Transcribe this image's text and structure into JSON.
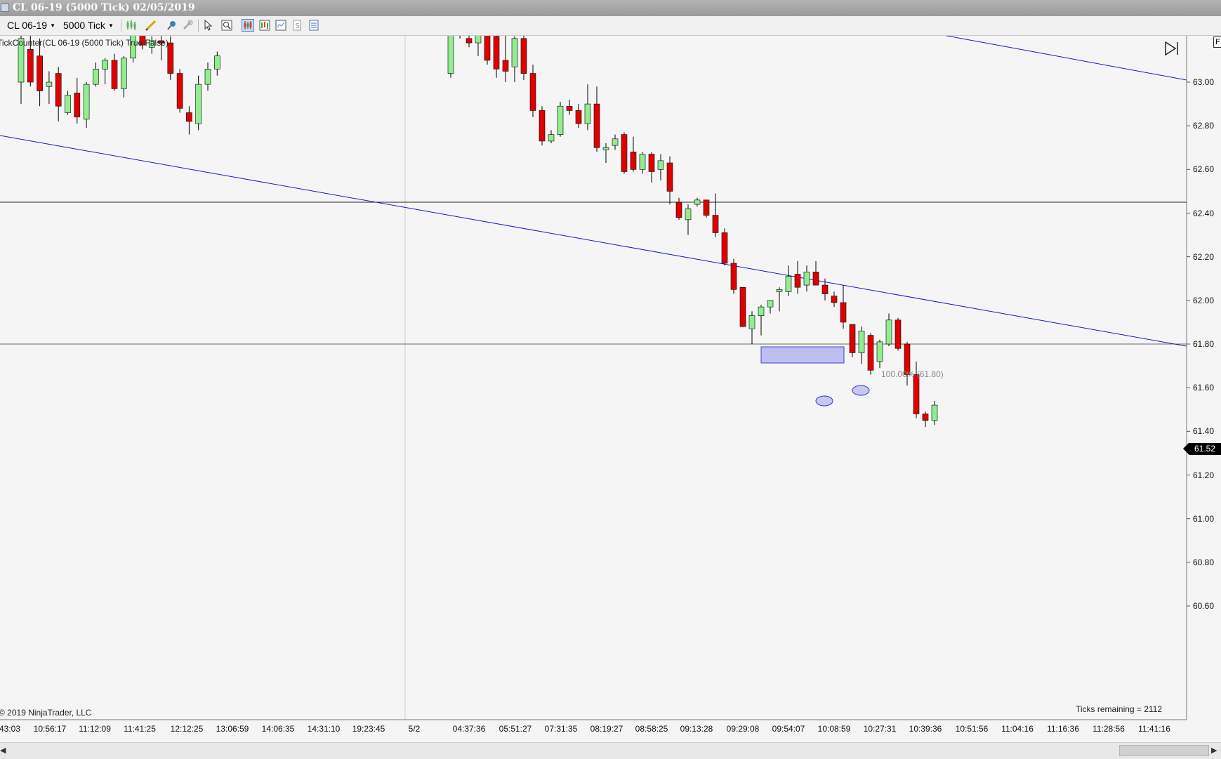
{
  "window": {
    "title": "CL 06-19 (5000 Tick)  02/05/2019"
  },
  "toolbar": {
    "instrument": "CL 06-19",
    "interval": "5000 Tick",
    "icons": [
      "bar-type-icon",
      "drawing-tools-icon",
      "marker-icon",
      "attach-icon",
      "cursor-icon",
      "zoom-icon",
      "chart-style-icon",
      "data-box-icon",
      "properties-icon",
      "strategy-icon",
      "indicators-icon"
    ]
  },
  "chart": {
    "indicator_label": "TickCounter(CL 06-19 (5000 Tick) True False)",
    "copyright": "© 2019 NinjaTrader, LLC",
    "ticks_remaining": "Ticks remaining = 2112",
    "last_price": "61.52",
    "fib_label": "100.00% (61.80)",
    "right_tab": "F"
  },
  "chart_data": {
    "type": "candlestick",
    "price_labels": [
      "63.00",
      "62.80",
      "62.60",
      "62.40",
      "62.20",
      "62.00",
      "61.80",
      "61.60",
      "61.40",
      "61.20",
      "61.00",
      "60.80",
      "60.60"
    ],
    "time_labels": [
      "43:03",
      "10:56:17",
      "11:12:09",
      "11:41:25",
      "12:12:25",
      "13:06:59",
      "14:06:35",
      "14:31:10",
      "19:23:45",
      "5/2",
      "04:37:36",
      "05:51:27",
      "07:31:35",
      "08:19:27",
      "08:58:25",
      "09:13:28",
      "09:29:08",
      "09:54:07",
      "10:08:59",
      "10:27:31",
      "10:39:36",
      "10:51:56",
      "11:04:16",
      "11:16:36",
      "11:28:56",
      "11:41:16"
    ],
    "ylim": [
      60.48,
      63.24
    ],
    "horizontal_lines": [
      62.45,
      61.8
    ],
    "colors": {
      "up": "#90ee90",
      "down": "#e00000",
      "trendline": "#1515d0",
      "zone": "#9999ee"
    },
    "candles": [
      {
        "o": 63.0,
        "h": 63.25,
        "l": 62.9,
        "c": 63.2
      },
      {
        "o": 63.15,
        "h": 63.3,
        "l": 62.98,
        "c": 63.0
      },
      {
        "o": 63.12,
        "h": 63.2,
        "l": 62.89,
        "c": 62.96
      },
      {
        "o": 62.98,
        "h": 63.05,
        "l": 62.9,
        "c": 63.0
      },
      {
        "o": 63.04,
        "h": 63.07,
        "l": 62.82,
        "c": 62.89
      },
      {
        "o": 62.86,
        "h": 62.96,
        "l": 62.85,
        "c": 62.94
      },
      {
        "o": 62.95,
        "h": 63.02,
        "l": 62.81,
        "c": 62.84
      },
      {
        "o": 62.83,
        "h": 63.0,
        "l": 62.79,
        "c": 62.99
      },
      {
        "o": 62.99,
        "h": 63.09,
        "l": 62.98,
        "c": 63.06
      },
      {
        "o": 63.06,
        "h": 63.11,
        "l": 62.99,
        "c": 63.1
      },
      {
        "o": 63.1,
        "h": 63.13,
        "l": 62.96,
        "c": 62.97
      },
      {
        "o": 62.97,
        "h": 63.12,
        "l": 62.93,
        "c": 63.11
      },
      {
        "o": 63.11,
        "h": 63.28,
        "l": 63.09,
        "c": 63.27
      },
      {
        "o": 63.27,
        "h": 63.32,
        "l": 63.15,
        "c": 63.17
      },
      {
        "o": 63.16,
        "h": 63.21,
        "l": 63.13,
        "c": 63.19
      },
      {
        "o": 63.19,
        "h": 63.22,
        "l": 63.1,
        "c": 63.18
      },
      {
        "o": 63.18,
        "h": 63.21,
        "l": 63.01,
        "c": 63.04
      },
      {
        "o": 63.04,
        "h": 63.06,
        "l": 62.86,
        "c": 62.88
      },
      {
        "o": 62.86,
        "h": 62.89,
        "l": 62.76,
        "c": 62.82
      },
      {
        "o": 62.81,
        "h": 63.03,
        "l": 62.78,
        "c": 62.99
      },
      {
        "o": 62.99,
        "h": 63.09,
        "l": 62.96,
        "c": 63.06
      },
      {
        "o": 63.06,
        "h": 63.14,
        "l": 63.03,
        "c": 63.12
      },
      {
        "o": 63.04,
        "h": 63.3,
        "l": 63.02,
        "c": 63.28
      },
      {
        "o": 63.28,
        "h": 63.33,
        "l": 63.2,
        "c": 63.3
      },
      {
        "o": 63.2,
        "h": 63.25,
        "l": 63.16,
        "c": 63.18
      },
      {
        "o": 63.18,
        "h": 63.26,
        "l": 63.12,
        "c": 63.24
      },
      {
        "o": 63.31,
        "h": 63.35,
        "l": 63.08,
        "c": 63.1
      },
      {
        "o": 63.21,
        "h": 63.27,
        "l": 63.02,
        "c": 63.06
      },
      {
        "o": 63.1,
        "h": 63.22,
        "l": 63.0,
        "c": 63.05
      },
      {
        "o": 63.07,
        "h": 63.21,
        "l": 63.0,
        "c": 63.2
      },
      {
        "o": 63.2,
        "h": 63.23,
        "l": 63.01,
        "c": 63.04
      },
      {
        "o": 63.04,
        "h": 63.08,
        "l": 62.84,
        "c": 62.87
      },
      {
        "o": 62.87,
        "h": 62.89,
        "l": 62.71,
        "c": 62.73
      },
      {
        "o": 62.73,
        "h": 62.78,
        "l": 62.72,
        "c": 62.76
      },
      {
        "o": 62.76,
        "h": 62.91,
        "l": 62.75,
        "c": 62.89
      },
      {
        "o": 62.89,
        "h": 62.92,
        "l": 62.85,
        "c": 62.87
      },
      {
        "o": 62.87,
        "h": 62.9,
        "l": 62.79,
        "c": 62.81
      },
      {
        "o": 62.81,
        "h": 62.99,
        "l": 62.78,
        "c": 62.9
      },
      {
        "o": 62.9,
        "h": 62.98,
        "l": 62.68,
        "c": 62.7
      },
      {
        "o": 62.69,
        "h": 62.72,
        "l": 62.63,
        "c": 62.7
      },
      {
        "o": 62.71,
        "h": 62.76,
        "l": 62.69,
        "c": 62.74
      },
      {
        "o": 62.76,
        "h": 62.77,
        "l": 62.58,
        "c": 62.59
      },
      {
        "o": 62.68,
        "h": 62.75,
        "l": 62.59,
        "c": 62.6
      },
      {
        "o": 62.6,
        "h": 62.68,
        "l": 62.58,
        "c": 62.67
      },
      {
        "o": 62.67,
        "h": 62.68,
        "l": 62.54,
        "c": 62.59
      },
      {
        "o": 62.6,
        "h": 62.67,
        "l": 62.55,
        "c": 62.64
      },
      {
        "o": 62.63,
        "h": 62.66,
        "l": 62.44,
        "c": 62.5
      },
      {
        "o": 62.45,
        "h": 62.47,
        "l": 62.37,
        "c": 62.38
      },
      {
        "o": 62.37,
        "h": 62.44,
        "l": 62.3,
        "c": 62.42
      },
      {
        "o": 62.44,
        "h": 62.47,
        "l": 62.43,
        "c": 62.46
      },
      {
        "o": 62.46,
        "h": 62.46,
        "l": 62.38,
        "c": 62.39
      },
      {
        "o": 62.39,
        "h": 62.49,
        "l": 62.29,
        "c": 62.31
      },
      {
        "o": 62.31,
        "h": 62.33,
        "l": 62.16,
        "c": 62.17
      },
      {
        "o": 62.17,
        "h": 62.19,
        "l": 62.03,
        "c": 62.05
      },
      {
        "o": 62.06,
        "h": 62.06,
        "l": 61.9,
        "c": 61.88
      },
      {
        "o": 61.87,
        "h": 61.95,
        "l": 61.8,
        "c": 61.93
      },
      {
        "o": 61.93,
        "h": 61.98,
        "l": 61.84,
        "c": 61.97
      },
      {
        "o": 61.97,
        "h": 62.0,
        "l": 61.94,
        "c": 62.0
      },
      {
        "o": 62.04,
        "h": 62.06,
        "l": 61.95,
        "c": 62.05
      },
      {
        "o": 62.04,
        "h": 62.16,
        "l": 62.02,
        "c": 62.11
      },
      {
        "o": 62.12,
        "h": 62.18,
        "l": 62.03,
        "c": 62.06
      },
      {
        "o": 62.07,
        "h": 62.16,
        "l": 62.04,
        "c": 62.13
      },
      {
        "o": 62.13,
        "h": 62.18,
        "l": 62.07,
        "c": 62.07
      },
      {
        "o": 62.07,
        "h": 62.1,
        "l": 62.0,
        "c": 62.03
      },
      {
        "o": 62.02,
        "h": 62.04,
        "l": 61.97,
        "c": 61.99
      },
      {
        "o": 61.99,
        "h": 62.07,
        "l": 61.87,
        "c": 61.9
      },
      {
        "o": 61.89,
        "h": 61.88,
        "l": 61.74,
        "c": 61.76
      },
      {
        "o": 61.76,
        "h": 61.88,
        "l": 61.71,
        "c": 61.86
      },
      {
        "o": 61.84,
        "h": 61.85,
        "l": 61.66,
        "c": 61.68
      },
      {
        "o": 61.72,
        "h": 61.82,
        "l": 61.69,
        "c": 61.81
      },
      {
        "o": 61.8,
        "h": 61.94,
        "l": 61.79,
        "c": 61.91
      },
      {
        "o": 61.91,
        "h": 61.92,
        "l": 61.77,
        "c": 61.78
      },
      {
        "o": 61.8,
        "h": 61.81,
        "l": 61.61,
        "c": 61.66
      },
      {
        "o": 61.66,
        "h": 61.72,
        "l": 61.46,
        "c": 61.48
      },
      {
        "o": 61.48,
        "h": 61.49,
        "l": 61.42,
        "c": 61.45
      },
      {
        "o": 61.45,
        "h": 61.54,
        "l": 61.43,
        "c": 61.52
      }
    ]
  }
}
